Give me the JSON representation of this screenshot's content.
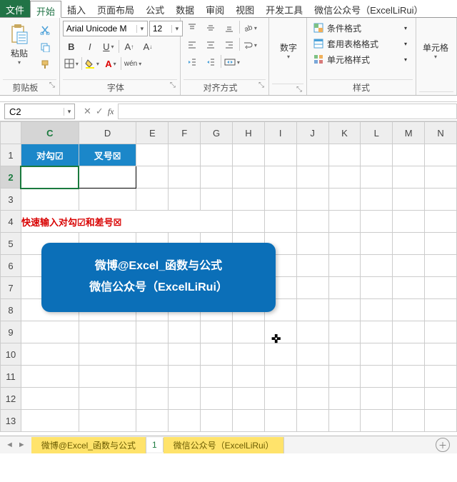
{
  "menu": {
    "file": "文件",
    "tabs": [
      "开始",
      "插入",
      "页面布局",
      "公式",
      "数据",
      "审阅",
      "视图",
      "开发工具",
      "微信公众号（ExcelLiRui）"
    ],
    "active": 0
  },
  "ribbon": {
    "clipboard": {
      "paste": "粘贴",
      "label": "剪贴板"
    },
    "font": {
      "name": "Arial Unicode M",
      "size": "12",
      "label": "字体",
      "wen": "wén"
    },
    "align": {
      "label": "对齐方式"
    },
    "number": {
      "btn": "数字",
      "label": ""
    },
    "styles": {
      "cond": "条件格式",
      "tablefmt": "套用表格格式",
      "cellfmt": "单元格样式",
      "label": "样式"
    },
    "cells": {
      "btn": "单元格"
    }
  },
  "namebox": "C2",
  "fx_label": "fx",
  "formula_value": "",
  "columns": [
    "C",
    "D",
    "E",
    "F",
    "G",
    "H",
    "I",
    "J",
    "K",
    "L",
    "M",
    "N"
  ],
  "col_widths": {
    "C": 80,
    "D": 80,
    "other": 44
  },
  "rows": [
    1,
    2,
    3,
    4,
    5,
    6,
    7,
    8,
    9,
    10,
    11,
    12,
    13
  ],
  "cells": {
    "C1": "对勾☑",
    "D1": "叉号☒",
    "C4_text": "快速输入对勾☑和差号☒"
  },
  "callout": {
    "line1": "微博@Excel_函数与公式",
    "line2": "微信公众号（ExcelLiRui）"
  },
  "sheets": {
    "tab1": "微博@Excel_函数与公式",
    "idx": "1",
    "tab2": "微信公众号（ExcelLiRui）"
  },
  "selected_cell": "C2"
}
